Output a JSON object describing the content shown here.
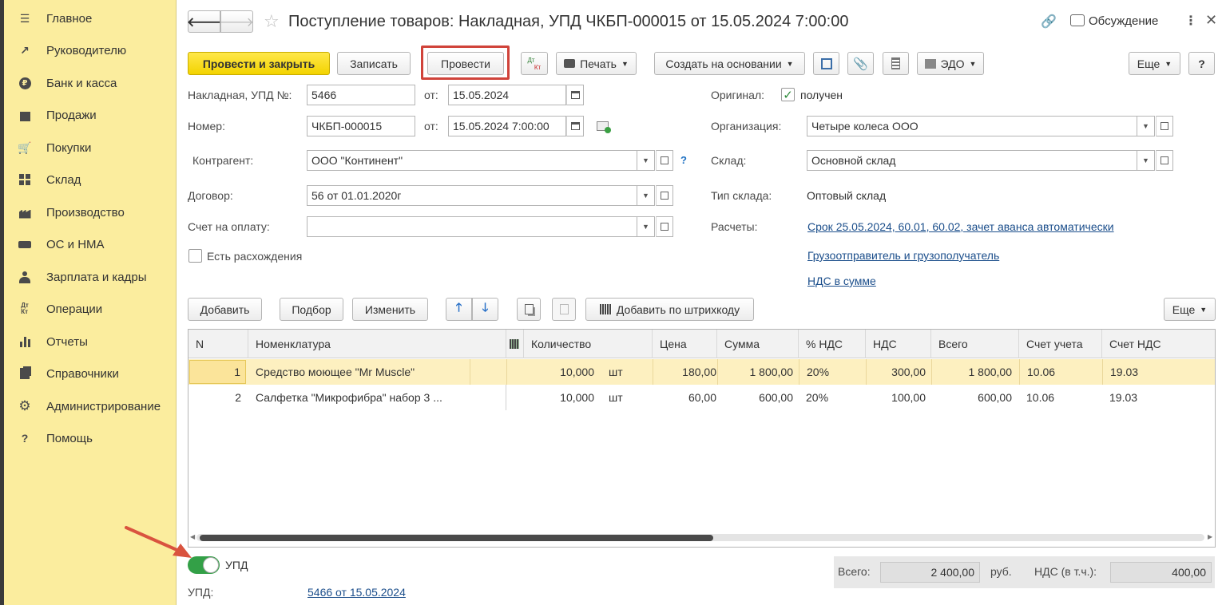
{
  "sidebar": {
    "items": [
      {
        "label": "Главное",
        "icon": "menu-lines-icon"
      },
      {
        "label": "Руководителю",
        "icon": "trend-icon"
      },
      {
        "label": "Банк и касса",
        "icon": "ruble-coin-icon"
      },
      {
        "label": "Продажи",
        "icon": "shopping-bag-icon"
      },
      {
        "label": "Покупки",
        "icon": "cart-icon"
      },
      {
        "label": "Склад",
        "icon": "warehouse-icon"
      },
      {
        "label": "Производство",
        "icon": "factory-icon"
      },
      {
        "label": "ОС и НМА",
        "icon": "truck-icon"
      },
      {
        "label": "Зарплата и кадры",
        "icon": "person-icon"
      },
      {
        "label": "Операции",
        "icon": "dt-kt-icon"
      },
      {
        "label": "Отчеты",
        "icon": "bar-chart-icon"
      },
      {
        "label": "Справочники",
        "icon": "books-icon"
      },
      {
        "label": "Администрирование",
        "icon": "gear-icon"
      },
      {
        "label": "Помощь",
        "icon": "help-icon"
      }
    ]
  },
  "header": {
    "title": "Поступление товаров: Накладная, УПД ЧКБП-000015 от 15.05.2024 7:00:00",
    "discussion_label": "Обсуждение"
  },
  "toolbar": {
    "post_close_label": "Провести и закрыть",
    "save_label": "Записать",
    "post_label": "Провести",
    "dtkt_top": "Дт",
    "dtkt_bottom": "Кт",
    "print_label": "Печать",
    "create_based_label": "Создать на основании",
    "edo_label": "ЭДО",
    "more_label": "Еще",
    "help_label": "?"
  },
  "form": {
    "invoice_label": "Накладная, УПД №:",
    "invoice_value": "5466",
    "from_label": "от:",
    "invoice_date": "15.05.2024",
    "number_label": "Номер:",
    "number_value": "ЧКБП-000015",
    "number_date": "15.05.2024  7:00:00",
    "contractor_label": "Контрагент:",
    "contractor_value": "ООО \"Континент\"",
    "contract_label": "Договор:",
    "contract_value": "56 от 01.01.2020г",
    "payment_label": "Счет на оплату:",
    "payment_value": "",
    "discrepancy_label": "Есть расхождения",
    "original_label": "Оригинал:",
    "original_value": "получен",
    "org_label": "Организация:",
    "org_value": "Четыре колеса ООО",
    "warehouse_label": "Склад:",
    "warehouse_value": "Основной склад",
    "warehouse_type_label": "Тип склада:",
    "warehouse_type_value": "Оптовый склад",
    "settlements_label": "Расчеты:",
    "settlements_link": "Срок 25.05.2024, 60.01, 60.02, зачет аванса автоматически",
    "shipper_link": "Грузоотправитель и грузополучатель",
    "vat_link": "НДС в сумме"
  },
  "table_toolbar": {
    "add_label": "Добавить",
    "pick_label": "Подбор",
    "edit_label": "Изменить",
    "barcode_label": "Добавить по штрихкоду",
    "more_label": "Еще"
  },
  "table": {
    "columns": {
      "n": "N",
      "item": "Номенклатура",
      "qty": "Количество",
      "price": "Цена",
      "sum": "Сумма",
      "vat_rate": "% НДС",
      "vat": "НДС",
      "total": "Всего",
      "account": "Счет учета",
      "vat_account": "Счет НДС"
    },
    "rows": [
      {
        "n": "1",
        "item": "Средство моющее \"Mr Muscle\"",
        "qty": "10,000",
        "unit": "шт",
        "price": "180,00",
        "sum": "1 800,00",
        "vat_rate": "20%",
        "vat": "300,00",
        "total": "1 800,00",
        "account": "10.06",
        "vat_account": "19.03"
      },
      {
        "n": "2",
        "item": "Салфетка \"Микрофибра\" набор 3 ...",
        "qty": "10,000",
        "unit": "шт",
        "price": "60,00",
        "sum": "600,00",
        "vat_rate": "20%",
        "vat": "100,00",
        "total": "600,00",
        "account": "10.06",
        "vat_account": "19.03"
      }
    ]
  },
  "footer": {
    "upd_toggle_label": "УПД",
    "upd_label": "УПД:",
    "upd_link": "5466 от 15.05.2024",
    "total_label": "Всего:",
    "total_value": "2 400,00",
    "currency": "руб.",
    "vat_label": "НДС (в т.ч.):",
    "vat_value": "400,00"
  },
  "colors": {
    "sidebar_bg": "#fbed9e",
    "primary_button": "#f3d300",
    "selected_row": "#fdf0c0",
    "highlight_box": "#d0433a",
    "link": "#1b4e8b",
    "toggle_on": "#33a047"
  }
}
